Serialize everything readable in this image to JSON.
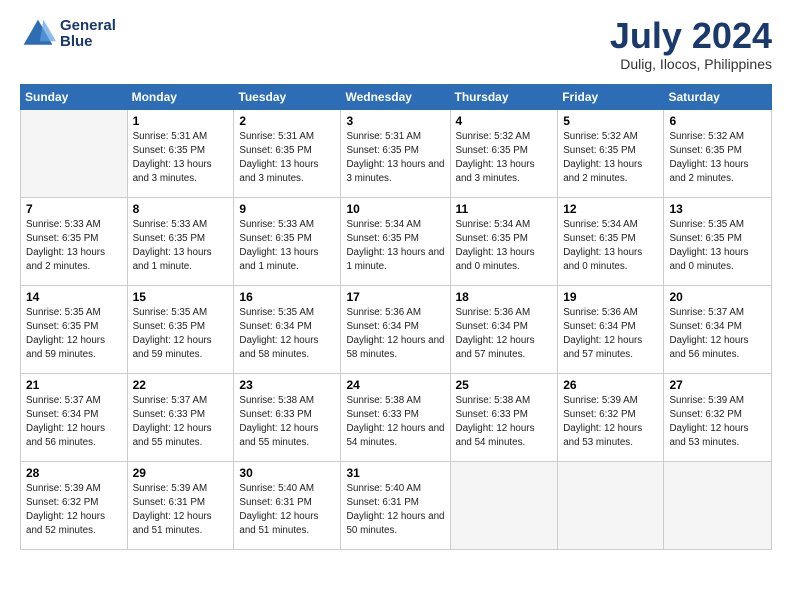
{
  "header": {
    "logo_line1": "General",
    "logo_line2": "Blue",
    "month_year": "July 2024",
    "location": "Dulig, Ilocos, Philippines"
  },
  "days_of_week": [
    "Sunday",
    "Monday",
    "Tuesday",
    "Wednesday",
    "Thursday",
    "Friday",
    "Saturday"
  ],
  "weeks": [
    [
      {
        "day": "",
        "sunrise": "",
        "sunset": "",
        "daylight": "",
        "empty": true
      },
      {
        "day": "1",
        "sunrise": "Sunrise: 5:31 AM",
        "sunset": "Sunset: 6:35 PM",
        "daylight": "Daylight: 13 hours and 3 minutes."
      },
      {
        "day": "2",
        "sunrise": "Sunrise: 5:31 AM",
        "sunset": "Sunset: 6:35 PM",
        "daylight": "Daylight: 13 hours and 3 minutes."
      },
      {
        "day": "3",
        "sunrise": "Sunrise: 5:31 AM",
        "sunset": "Sunset: 6:35 PM",
        "daylight": "Daylight: 13 hours and 3 minutes."
      },
      {
        "day": "4",
        "sunrise": "Sunrise: 5:32 AM",
        "sunset": "Sunset: 6:35 PM",
        "daylight": "Daylight: 13 hours and 3 minutes."
      },
      {
        "day": "5",
        "sunrise": "Sunrise: 5:32 AM",
        "sunset": "Sunset: 6:35 PM",
        "daylight": "Daylight: 13 hours and 2 minutes."
      },
      {
        "day": "6",
        "sunrise": "Sunrise: 5:32 AM",
        "sunset": "Sunset: 6:35 PM",
        "daylight": "Daylight: 13 hours and 2 minutes."
      }
    ],
    [
      {
        "day": "7",
        "sunrise": "Sunrise: 5:33 AM",
        "sunset": "Sunset: 6:35 PM",
        "daylight": "Daylight: 13 hours and 2 minutes."
      },
      {
        "day": "8",
        "sunrise": "Sunrise: 5:33 AM",
        "sunset": "Sunset: 6:35 PM",
        "daylight": "Daylight: 13 hours and 1 minute."
      },
      {
        "day": "9",
        "sunrise": "Sunrise: 5:33 AM",
        "sunset": "Sunset: 6:35 PM",
        "daylight": "Daylight: 13 hours and 1 minute."
      },
      {
        "day": "10",
        "sunrise": "Sunrise: 5:34 AM",
        "sunset": "Sunset: 6:35 PM",
        "daylight": "Daylight: 13 hours and 1 minute."
      },
      {
        "day": "11",
        "sunrise": "Sunrise: 5:34 AM",
        "sunset": "Sunset: 6:35 PM",
        "daylight": "Daylight: 13 hours and 0 minutes."
      },
      {
        "day": "12",
        "sunrise": "Sunrise: 5:34 AM",
        "sunset": "Sunset: 6:35 PM",
        "daylight": "Daylight: 13 hours and 0 minutes."
      },
      {
        "day": "13",
        "sunrise": "Sunrise: 5:35 AM",
        "sunset": "Sunset: 6:35 PM",
        "daylight": "Daylight: 13 hours and 0 minutes."
      }
    ],
    [
      {
        "day": "14",
        "sunrise": "Sunrise: 5:35 AM",
        "sunset": "Sunset: 6:35 PM",
        "daylight": "Daylight: 12 hours and 59 minutes."
      },
      {
        "day": "15",
        "sunrise": "Sunrise: 5:35 AM",
        "sunset": "Sunset: 6:35 PM",
        "daylight": "Daylight: 12 hours and 59 minutes."
      },
      {
        "day": "16",
        "sunrise": "Sunrise: 5:35 AM",
        "sunset": "Sunset: 6:34 PM",
        "daylight": "Daylight: 12 hours and 58 minutes."
      },
      {
        "day": "17",
        "sunrise": "Sunrise: 5:36 AM",
        "sunset": "Sunset: 6:34 PM",
        "daylight": "Daylight: 12 hours and 58 minutes."
      },
      {
        "day": "18",
        "sunrise": "Sunrise: 5:36 AM",
        "sunset": "Sunset: 6:34 PM",
        "daylight": "Daylight: 12 hours and 57 minutes."
      },
      {
        "day": "19",
        "sunrise": "Sunrise: 5:36 AM",
        "sunset": "Sunset: 6:34 PM",
        "daylight": "Daylight: 12 hours and 57 minutes."
      },
      {
        "day": "20",
        "sunrise": "Sunrise: 5:37 AM",
        "sunset": "Sunset: 6:34 PM",
        "daylight": "Daylight: 12 hours and 56 minutes."
      }
    ],
    [
      {
        "day": "21",
        "sunrise": "Sunrise: 5:37 AM",
        "sunset": "Sunset: 6:34 PM",
        "daylight": "Daylight: 12 hours and 56 minutes."
      },
      {
        "day": "22",
        "sunrise": "Sunrise: 5:37 AM",
        "sunset": "Sunset: 6:33 PM",
        "daylight": "Daylight: 12 hours and 55 minutes."
      },
      {
        "day": "23",
        "sunrise": "Sunrise: 5:38 AM",
        "sunset": "Sunset: 6:33 PM",
        "daylight": "Daylight: 12 hours and 55 minutes."
      },
      {
        "day": "24",
        "sunrise": "Sunrise: 5:38 AM",
        "sunset": "Sunset: 6:33 PM",
        "daylight": "Daylight: 12 hours and 54 minutes."
      },
      {
        "day": "25",
        "sunrise": "Sunrise: 5:38 AM",
        "sunset": "Sunset: 6:33 PM",
        "daylight": "Daylight: 12 hours and 54 minutes."
      },
      {
        "day": "26",
        "sunrise": "Sunrise: 5:39 AM",
        "sunset": "Sunset: 6:32 PM",
        "daylight": "Daylight: 12 hours and 53 minutes."
      },
      {
        "day": "27",
        "sunrise": "Sunrise: 5:39 AM",
        "sunset": "Sunset: 6:32 PM",
        "daylight": "Daylight: 12 hours and 53 minutes."
      }
    ],
    [
      {
        "day": "28",
        "sunrise": "Sunrise: 5:39 AM",
        "sunset": "Sunset: 6:32 PM",
        "daylight": "Daylight: 12 hours and 52 minutes."
      },
      {
        "day": "29",
        "sunrise": "Sunrise: 5:39 AM",
        "sunset": "Sunset: 6:31 PM",
        "daylight": "Daylight: 12 hours and 51 minutes."
      },
      {
        "day": "30",
        "sunrise": "Sunrise: 5:40 AM",
        "sunset": "Sunset: 6:31 PM",
        "daylight": "Daylight: 12 hours and 51 minutes."
      },
      {
        "day": "31",
        "sunrise": "Sunrise: 5:40 AM",
        "sunset": "Sunset: 6:31 PM",
        "daylight": "Daylight: 12 hours and 50 minutes."
      },
      {
        "day": "",
        "sunrise": "",
        "sunset": "",
        "daylight": "",
        "empty": true
      },
      {
        "day": "",
        "sunrise": "",
        "sunset": "",
        "daylight": "",
        "empty": true
      },
      {
        "day": "",
        "sunrise": "",
        "sunset": "",
        "daylight": "",
        "empty": true
      }
    ]
  ]
}
